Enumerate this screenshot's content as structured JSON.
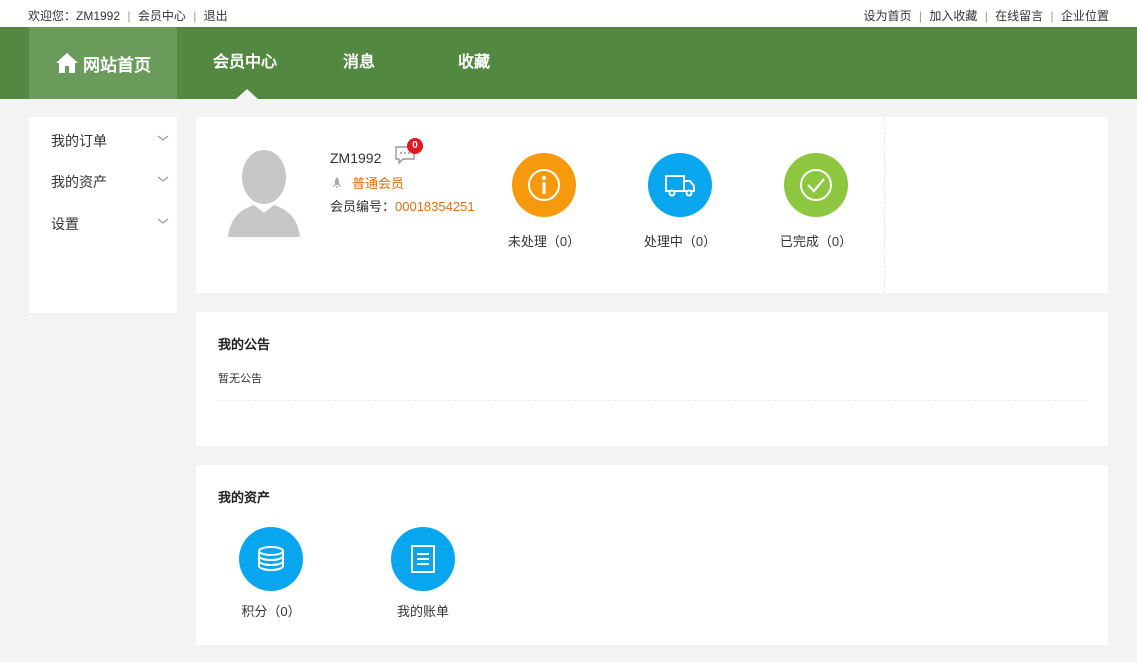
{
  "topbar": {
    "welcome": "欢迎您：ZM1992",
    "member_center": "会员中心",
    "logout": "退出",
    "set_home": "设为首页",
    "add_favorite": "加入收藏",
    "online_message": "在线留言",
    "company_location": "企业位置"
  },
  "nav": {
    "home": "网站首页",
    "member_center": "会员中心",
    "messages": "消息",
    "favorites": "收藏",
    "accent": "#52883f",
    "home_bg": "#6b9b5b"
  },
  "sidebar": {
    "items": [
      {
        "label": "我的订单"
      },
      {
        "label": "我的资产"
      },
      {
        "label": "设置"
      }
    ]
  },
  "profile": {
    "username": "ZM1992",
    "unread_count": "0",
    "level": "普通会员",
    "member_no_label": "会员编号：",
    "member_no": "00018354251",
    "stats": [
      {
        "label": "未处理（0）",
        "icon": "info-icon",
        "color": "#f7990d"
      },
      {
        "label": "处理中（0）",
        "icon": "truck-icon",
        "color": "#09a6f0"
      },
      {
        "label": "已完成（0）",
        "icon": "check-icon",
        "color": "#8dc63f"
      }
    ]
  },
  "notice": {
    "title": "我的公告",
    "empty_text": "暂无公告"
  },
  "assets": {
    "title": "我的资产",
    "items": [
      {
        "label": "积分（0）",
        "icon": "coins-icon"
      },
      {
        "label": "我的账单",
        "icon": "bill-icon"
      }
    ]
  }
}
